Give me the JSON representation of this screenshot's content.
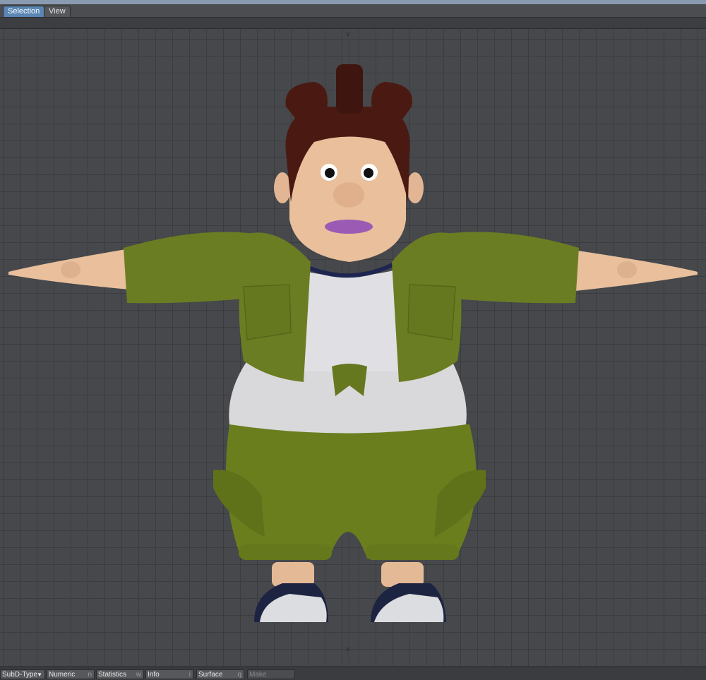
{
  "tabs": {
    "selection": "Selection",
    "view": "View"
  },
  "toolbar": {
    "subd": "SubD-Type",
    "numeric": "Numeric",
    "numeric_key": "n",
    "statistics": "Statistics",
    "statistics_key": "w",
    "info": "Info",
    "info_key": "i",
    "surface": "Surface",
    "surface_key": "q",
    "make": "Make"
  },
  "colors": {
    "tab_active": "#5a86b4",
    "grid": "#46484b",
    "jacket": "#6b7d22",
    "pants": "#6a7e1e",
    "skin": "#e9bf9c",
    "hair": "#4a1a12"
  }
}
